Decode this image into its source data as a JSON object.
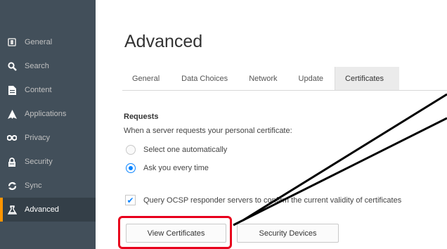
{
  "sidebar": {
    "items": [
      {
        "label": "General",
        "icon": "general-icon"
      },
      {
        "label": "Search",
        "icon": "search-icon"
      },
      {
        "label": "Content",
        "icon": "content-icon"
      },
      {
        "label": "Applications",
        "icon": "applications-icon"
      },
      {
        "label": "Privacy",
        "icon": "privacy-icon"
      },
      {
        "label": "Security",
        "icon": "lock-icon"
      },
      {
        "label": "Sync",
        "icon": "sync-icon"
      },
      {
        "label": "Advanced",
        "icon": "advanced-icon",
        "active": true
      }
    ]
  },
  "main": {
    "title": "Advanced",
    "tabs": [
      {
        "label": "General"
      },
      {
        "label": "Data Choices"
      },
      {
        "label": "Network"
      },
      {
        "label": "Update"
      },
      {
        "label": "Certificates",
        "selected": true
      }
    ],
    "requests": {
      "heading": "Requests",
      "prompt": "When a server requests your personal certificate:",
      "option_auto": "Select one automatically",
      "option_ask": "Ask you every time",
      "selected": "ask"
    },
    "ocsp": {
      "label": "Query OCSP responder servers to confirm the current validity of certificates",
      "checked": true
    },
    "buttons": {
      "view_certificates": "View Certificates",
      "security_devices": "Security Devices"
    }
  },
  "colors": {
    "sidebar_bg": "#424f5a",
    "accent": "#0a84ff",
    "highlight": "#e8001c"
  }
}
